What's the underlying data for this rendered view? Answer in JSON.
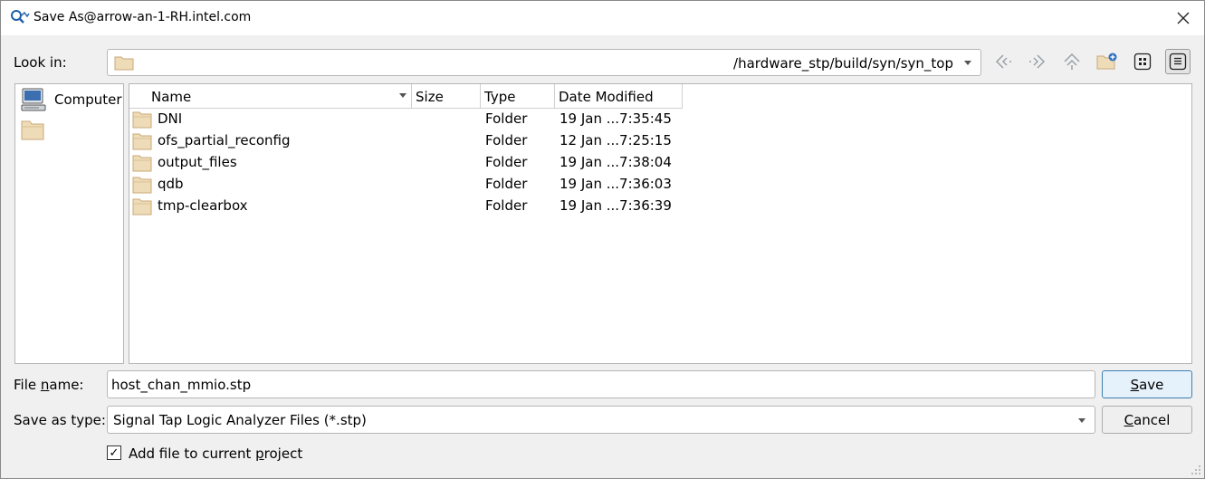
{
  "window": {
    "title": "Save As@arrow-an-1-RH.intel.com",
    "close_symbol": "✕"
  },
  "lookin": {
    "label": "Look in:",
    "path": "/hardware_stp/build/syn/syn_top"
  },
  "toolbar": {
    "back_icon": "back-icon",
    "forward_icon": "forward-icon",
    "up_icon": "parent-directory-icon",
    "new_folder_icon": "new-folder-icon",
    "list_view_icon": "list-view-icon",
    "detail_view_icon": "detail-view-icon"
  },
  "sidebar": {
    "items": [
      {
        "label": "Computer",
        "icon": "computer-icon"
      },
      {
        "label": "",
        "icon": "folder-icon"
      }
    ]
  },
  "files": {
    "columns": [
      "Name",
      "Size",
      "Type",
      "Date Modified"
    ],
    "rows": [
      {
        "name": "DNI",
        "size": "",
        "type": "Folder",
        "date": "19 Jan ...7:35:45"
      },
      {
        "name": "ofs_partial_reconfig",
        "size": "",
        "type": "Folder",
        "date": "12 Jan ...7:25:15"
      },
      {
        "name": "output_files",
        "size": "",
        "type": "Folder",
        "date": "19 Jan ...7:38:04"
      },
      {
        "name": "qdb",
        "size": "",
        "type": "Folder",
        "date": "19 Jan ...7:36:03"
      },
      {
        "name": "tmp-clearbox",
        "size": "",
        "type": "Folder",
        "date": "19 Jan ...7:36:39"
      }
    ]
  },
  "filename": {
    "label_pre": "File ",
    "label_mnemonic": "n",
    "label_post": "ame:",
    "value": "host_chan_mmio.stp"
  },
  "filetype": {
    "label": "Save as type:",
    "value": "Signal Tap Logic Analyzer Files (*.stp)"
  },
  "buttons": {
    "save_mnemonic": "S",
    "save_rest": "ave",
    "cancel_mnemonic": "C",
    "cancel_rest": "ancel"
  },
  "add_to_project": {
    "checked": true,
    "check_mark": "✓",
    "label_pre": "Add file to current ",
    "label_mnemonic": "p",
    "label_post": "roject"
  }
}
